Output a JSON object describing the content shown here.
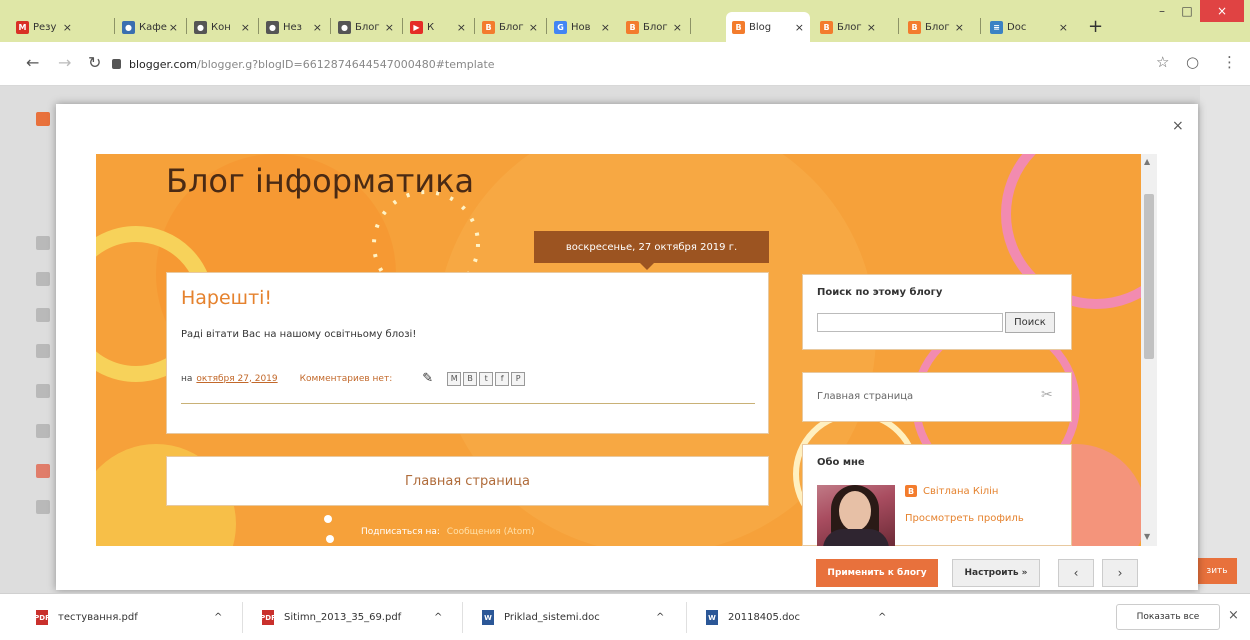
{
  "tabs": [
    {
      "label": "Резу",
      "favicon": "gmail-icon",
      "color": "#d93025",
      "glyph": "M"
    },
    {
      "label": "Кафе",
      "favicon": "globe-icon",
      "color": "#3a6fb0",
      "glyph": "●"
    },
    {
      "label": "Кон",
      "favicon": "web-icon",
      "color": "#555555",
      "glyph": "●"
    },
    {
      "label": "Нез",
      "favicon": "web-icon",
      "color": "#555555",
      "glyph": "●"
    },
    {
      "label": "Блог",
      "favicon": "web-icon",
      "color": "#555555",
      "glyph": "●"
    },
    {
      "label": "К",
      "favicon": "youtube-icon",
      "color": "#e52d27",
      "glyph": "▶"
    },
    {
      "label": "Блог",
      "favicon": "blogger-icon",
      "color": "#f37c2d",
      "glyph": "B"
    },
    {
      "label": "Нов",
      "favicon": "google-icon",
      "color": "#4285f4",
      "glyph": "G"
    },
    {
      "label": "Blog",
      "favicon": "blogger-icon",
      "color": "#f37c2d",
      "glyph": "B"
    },
    {
      "label": "Блог",
      "favicon": "blogger-icon",
      "color": "#f37c2d",
      "glyph": "B"
    },
    {
      "label": "Блог",
      "favicon": "blogger-icon",
      "color": "#f37c2d",
      "glyph": "B"
    },
    {
      "label": "Doc",
      "favicon": "docs-icon",
      "color": "#3b82c4",
      "glyph": "≡"
    }
  ],
  "active_tab": 8,
  "browser": {
    "url_host": "blogger.com",
    "url_path": "/blogger.g?blogID=6612874644547000480#template"
  },
  "preview": {
    "blog_title": "Блог інформатика",
    "date_header": "воскресенье, 27 октября 2019 г.",
    "post": {
      "title": "Нарешті!",
      "body": "Раді вітати Вас на нашому освітньому блозі!",
      "footer_prefix": "на",
      "date_link": "октября 27, 2019",
      "comments": "Комментариев нет:",
      "share": [
        "M",
        "B",
        "t",
        "f",
        "P"
      ]
    },
    "home_link": "Главная страница",
    "subscribe_label": "Подписаться на:",
    "subscribe_link": "Сообщения (Atom)",
    "search_widget": {
      "title": "Поиск по этому блогу",
      "button": "Поиск"
    },
    "pages_widget": {
      "link": "Главная страница"
    },
    "about_widget": {
      "title": "Обо мне",
      "name": "Світлана Кілін",
      "profile_link": "Просмотреть профиль"
    }
  },
  "modal": {
    "apply_label": "Применить к блогу",
    "customize_label": "Настроить »",
    "prev_label": "‹",
    "next_label": "›",
    "close_label": "×"
  },
  "background_page": {
    "button_label": "зить"
  },
  "downloads": [
    {
      "name": "тестування.pdf",
      "type": "pdf"
    },
    {
      "name": "Sitimn_2013_35_69.pdf",
      "type": "pdf"
    },
    {
      "name": "Priklad_sistemi.doc",
      "type": "doc"
    },
    {
      "name": "20118405.doc",
      "type": "doc"
    }
  ],
  "downloads_show_all": "Показать все",
  "colors": {
    "blog_bg": "#f6a13a",
    "accent": "#e8713c",
    "post_title": "#e5822e",
    "date_header_bg": "#9c5421",
    "title_text": "#4a2a14"
  }
}
